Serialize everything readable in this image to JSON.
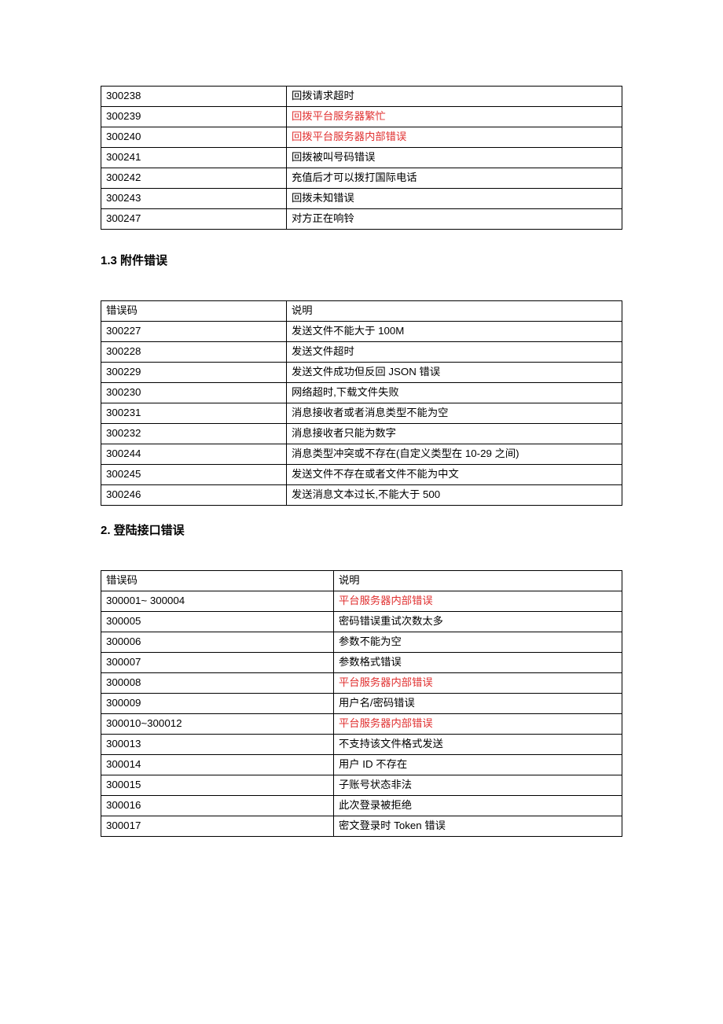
{
  "labels": {
    "col_code": "错误码",
    "col_desc": "说明"
  },
  "section1": {
    "rows": [
      {
        "code": "300238",
        "desc": "回拨请求超时",
        "red": false
      },
      {
        "code": "300239",
        "desc": "回拨平台服务器繁忙",
        "red": true
      },
      {
        "code": "300240",
        "desc": "回拨平台服务器内部错误",
        "red": true
      },
      {
        "code": "300241",
        "desc": "回拨被叫号码错误",
        "red": false
      },
      {
        "code": "300242",
        "desc": "充值后才可以拨打国际电话",
        "red": false
      },
      {
        "code": "300243",
        "desc": "回拨未知错误",
        "red": false
      },
      {
        "code": "300247",
        "desc": "对方正在响铃",
        "red": false
      }
    ]
  },
  "section2": {
    "heading": "1.3   附件错误",
    "rows": [
      {
        "code": "300227",
        "desc": "发送文件不能大于 100M",
        "red": false
      },
      {
        "code": "300228",
        "desc": "发送文件超时",
        "red": false
      },
      {
        "code": "300229",
        "desc": "发送文件成功但反回 JSON 错误",
        "red": false
      },
      {
        "code": "300230",
        "desc": "网络超时,下载文件失败",
        "red": false
      },
      {
        "code": "300231",
        "desc": "消息接收者或者消息类型不能为空",
        "red": false
      },
      {
        "code": "300232",
        "desc": "消息接收者只能为数字",
        "red": false
      },
      {
        "code": "300244",
        "desc": "消息类型冲突或不存在(自定义类型在 10-29 之间)",
        "red": false
      },
      {
        "code": "300245",
        "desc": "发送文件不存在或者文件不能为中文",
        "red": false
      },
      {
        "code": "300246",
        "desc": "发送消息文本过长,不能大于 500",
        "red": false
      }
    ]
  },
  "section3": {
    "heading": "2.   登陆接口错误",
    "rows": [
      {
        "code": "300001~ 300004",
        "desc": "平台服务器内部错误",
        "red": true
      },
      {
        "code": "300005",
        "desc": "密码错误重试次数太多",
        "red": false
      },
      {
        "code": "300006",
        "desc": "参数不能为空",
        "red": false
      },
      {
        "code": "300007",
        "desc": "参数格式错误",
        "red": false
      },
      {
        "code": "300008",
        "desc": "平台服务器内部错误",
        "red": true
      },
      {
        "code": "300009",
        "desc": "用户名/密码错误",
        "red": false
      },
      {
        "code": "300010~300012",
        "desc": "平台服务器内部错误",
        "red": true
      },
      {
        "code": "300013",
        "desc": "不支持该文件格式发送",
        "red": false
      },
      {
        "code": "300014",
        "desc": "用户 ID 不存在",
        "red": false
      },
      {
        "code": "300015",
        "desc": "子账号状态非法",
        "red": false
      },
      {
        "code": "300016",
        "desc": "此次登录被拒绝",
        "red": false
      },
      {
        "code": "300017",
        "desc": "密文登录时 Token 错误",
        "red": false
      }
    ]
  }
}
